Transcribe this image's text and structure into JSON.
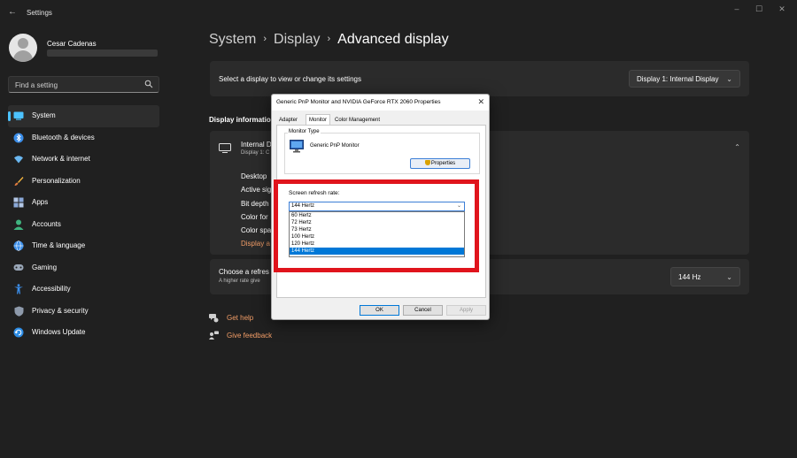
{
  "window": {
    "app_title": "Settings",
    "back_glyph": "←",
    "minimize_glyph": "–",
    "maximize_glyph": "☐",
    "close_glyph": "✕"
  },
  "user": {
    "name": "Cesar Cadenas"
  },
  "search": {
    "placeholder": "Find a setting"
  },
  "sidebar": {
    "items": [
      {
        "label": "System",
        "icon": "system-icon",
        "active": true
      },
      {
        "label": "Bluetooth & devices",
        "icon": "bluetooth-icon"
      },
      {
        "label": "Network & internet",
        "icon": "network-icon"
      },
      {
        "label": "Personalization",
        "icon": "brush-icon"
      },
      {
        "label": "Apps",
        "icon": "apps-icon"
      },
      {
        "label": "Accounts",
        "icon": "accounts-icon"
      },
      {
        "label": "Time & language",
        "icon": "globe-icon"
      },
      {
        "label": "Gaming",
        "icon": "gamepad-icon"
      },
      {
        "label": "Accessibility",
        "icon": "accessibility-icon"
      },
      {
        "label": "Privacy & security",
        "icon": "shield-icon"
      },
      {
        "label": "Windows Update",
        "icon": "update-icon"
      }
    ]
  },
  "breadcrumb": {
    "level1": "System",
    "level2": "Display",
    "current": "Advanced display",
    "separator": "›"
  },
  "display_select": {
    "label": "Select a display to view or change its settings",
    "value": "Display 1: Internal Display",
    "chevron": "⌄"
  },
  "display_info": {
    "section_title": "Display informatio",
    "card_title": "Internal D",
    "card_sub": "Display 1: C",
    "chevron": "⌃",
    "rows": [
      "Desktop",
      "Active sig",
      "Bit depth",
      "Color for",
      "Color spa",
      "Display a"
    ]
  },
  "refresh": {
    "title": "Choose a refres",
    "subtitle": "A higher rate give",
    "value": "144 Hz",
    "chevron": "⌄"
  },
  "links": {
    "help": "Get help",
    "feedback": "Give feedback"
  },
  "dialog": {
    "title": "Generic PnP Monitor and NVIDIA GeForce RTX 2060 Properties",
    "close_glyph": "✕",
    "tabs": [
      "Adapter",
      "Monitor",
      "Color Management"
    ],
    "active_tab": "Monitor",
    "monitor_type_legend": "Monitor Type",
    "monitor_name": "Generic PnP Monitor",
    "properties_button": "Properties",
    "refresh_label": "Screen refresh rate:",
    "refresh_selected": "144 Hertz",
    "refresh_options": [
      "60 Hertz",
      "72 Hertz",
      "73 Hertz",
      "100 Hertz",
      "120 Hertz",
      "144 Hertz"
    ],
    "ok": "OK",
    "cancel": "Cancel",
    "apply": "Apply"
  },
  "colors": {
    "background": "#202020",
    "card": "#2b2b2b",
    "accent": "#4cc2ff",
    "link": "#f29d67",
    "highlight": "#e0141c",
    "selection": "#0078d7"
  }
}
